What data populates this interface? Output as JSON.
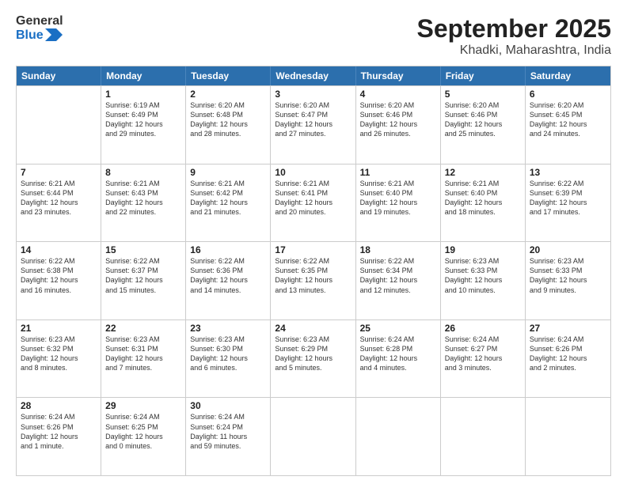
{
  "logo": {
    "line1": "General",
    "line2": "Blue"
  },
  "header": {
    "month": "September 2025",
    "location": "Khadki, Maharashtra, India"
  },
  "weekdays": [
    "Sunday",
    "Monday",
    "Tuesday",
    "Wednesday",
    "Thursday",
    "Friday",
    "Saturday"
  ],
  "rows": [
    [
      {
        "day": "",
        "info": ""
      },
      {
        "day": "1",
        "info": "Sunrise: 6:19 AM\nSunset: 6:49 PM\nDaylight: 12 hours\nand 29 minutes."
      },
      {
        "day": "2",
        "info": "Sunrise: 6:20 AM\nSunset: 6:48 PM\nDaylight: 12 hours\nand 28 minutes."
      },
      {
        "day": "3",
        "info": "Sunrise: 6:20 AM\nSunset: 6:47 PM\nDaylight: 12 hours\nand 27 minutes."
      },
      {
        "day": "4",
        "info": "Sunrise: 6:20 AM\nSunset: 6:46 PM\nDaylight: 12 hours\nand 26 minutes."
      },
      {
        "day": "5",
        "info": "Sunrise: 6:20 AM\nSunset: 6:46 PM\nDaylight: 12 hours\nand 25 minutes."
      },
      {
        "day": "6",
        "info": "Sunrise: 6:20 AM\nSunset: 6:45 PM\nDaylight: 12 hours\nand 24 minutes."
      }
    ],
    [
      {
        "day": "7",
        "info": "Sunrise: 6:21 AM\nSunset: 6:44 PM\nDaylight: 12 hours\nand 23 minutes."
      },
      {
        "day": "8",
        "info": "Sunrise: 6:21 AM\nSunset: 6:43 PM\nDaylight: 12 hours\nand 22 minutes."
      },
      {
        "day": "9",
        "info": "Sunrise: 6:21 AM\nSunset: 6:42 PM\nDaylight: 12 hours\nand 21 minutes."
      },
      {
        "day": "10",
        "info": "Sunrise: 6:21 AM\nSunset: 6:41 PM\nDaylight: 12 hours\nand 20 minutes."
      },
      {
        "day": "11",
        "info": "Sunrise: 6:21 AM\nSunset: 6:40 PM\nDaylight: 12 hours\nand 19 minutes."
      },
      {
        "day": "12",
        "info": "Sunrise: 6:21 AM\nSunset: 6:40 PM\nDaylight: 12 hours\nand 18 minutes."
      },
      {
        "day": "13",
        "info": "Sunrise: 6:22 AM\nSunset: 6:39 PM\nDaylight: 12 hours\nand 17 minutes."
      }
    ],
    [
      {
        "day": "14",
        "info": "Sunrise: 6:22 AM\nSunset: 6:38 PM\nDaylight: 12 hours\nand 16 minutes."
      },
      {
        "day": "15",
        "info": "Sunrise: 6:22 AM\nSunset: 6:37 PM\nDaylight: 12 hours\nand 15 minutes."
      },
      {
        "day": "16",
        "info": "Sunrise: 6:22 AM\nSunset: 6:36 PM\nDaylight: 12 hours\nand 14 minutes."
      },
      {
        "day": "17",
        "info": "Sunrise: 6:22 AM\nSunset: 6:35 PM\nDaylight: 12 hours\nand 13 minutes."
      },
      {
        "day": "18",
        "info": "Sunrise: 6:22 AM\nSunset: 6:34 PM\nDaylight: 12 hours\nand 12 minutes."
      },
      {
        "day": "19",
        "info": "Sunrise: 6:23 AM\nSunset: 6:33 PM\nDaylight: 12 hours\nand 10 minutes."
      },
      {
        "day": "20",
        "info": "Sunrise: 6:23 AM\nSunset: 6:33 PM\nDaylight: 12 hours\nand 9 minutes."
      }
    ],
    [
      {
        "day": "21",
        "info": "Sunrise: 6:23 AM\nSunset: 6:32 PM\nDaylight: 12 hours\nand 8 minutes."
      },
      {
        "day": "22",
        "info": "Sunrise: 6:23 AM\nSunset: 6:31 PM\nDaylight: 12 hours\nand 7 minutes."
      },
      {
        "day": "23",
        "info": "Sunrise: 6:23 AM\nSunset: 6:30 PM\nDaylight: 12 hours\nand 6 minutes."
      },
      {
        "day": "24",
        "info": "Sunrise: 6:23 AM\nSunset: 6:29 PM\nDaylight: 12 hours\nand 5 minutes."
      },
      {
        "day": "25",
        "info": "Sunrise: 6:24 AM\nSunset: 6:28 PM\nDaylight: 12 hours\nand 4 minutes."
      },
      {
        "day": "26",
        "info": "Sunrise: 6:24 AM\nSunset: 6:27 PM\nDaylight: 12 hours\nand 3 minutes."
      },
      {
        "day": "27",
        "info": "Sunrise: 6:24 AM\nSunset: 6:26 PM\nDaylight: 12 hours\nand 2 minutes."
      }
    ],
    [
      {
        "day": "28",
        "info": "Sunrise: 6:24 AM\nSunset: 6:26 PM\nDaylight: 12 hours\nand 1 minute."
      },
      {
        "day": "29",
        "info": "Sunrise: 6:24 AM\nSunset: 6:25 PM\nDaylight: 12 hours\nand 0 minutes."
      },
      {
        "day": "30",
        "info": "Sunrise: 6:24 AM\nSunset: 6:24 PM\nDaylight: 11 hours\nand 59 minutes."
      },
      {
        "day": "",
        "info": ""
      },
      {
        "day": "",
        "info": ""
      },
      {
        "day": "",
        "info": ""
      },
      {
        "day": "",
        "info": ""
      }
    ]
  ]
}
